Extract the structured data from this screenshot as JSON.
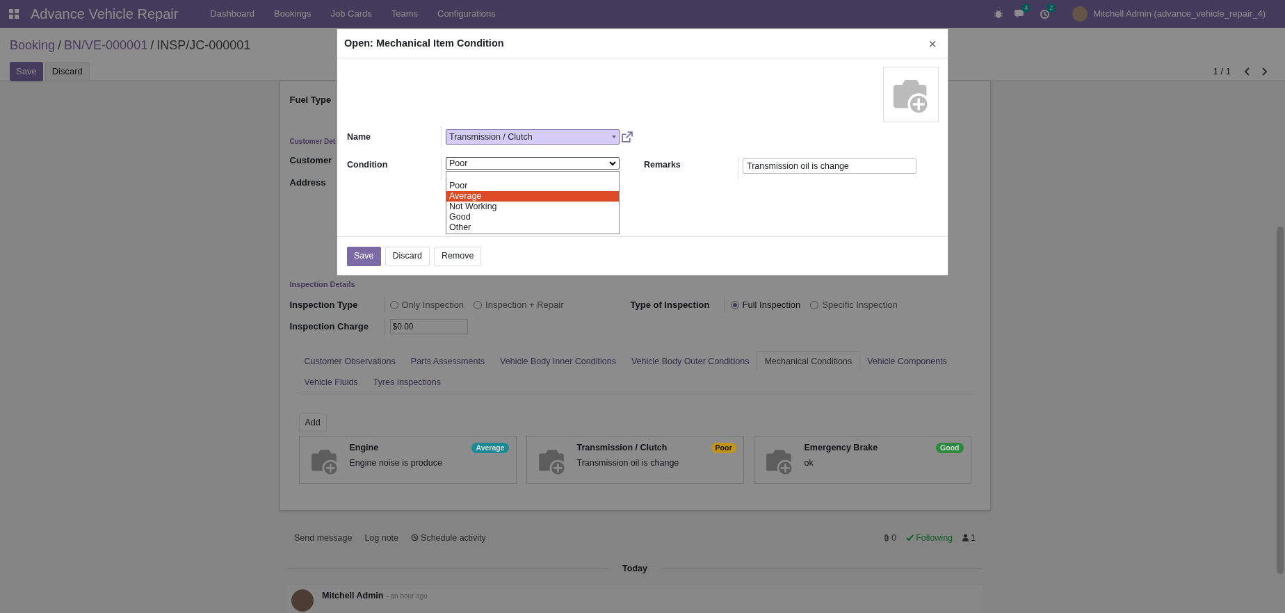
{
  "navbar": {
    "app_title": "Advance Vehicle Repair",
    "menu": [
      "Dashboard",
      "Bookings",
      "Job Cards",
      "Teams",
      "Configurations"
    ],
    "messages_count": "4",
    "activities_count": "2",
    "user": "Mitchell Admin (advance_vehicle_repair_4)"
  },
  "breadcrumb": [
    {
      "label": "Booking",
      "separator": "/"
    },
    {
      "label": "BN/VE-000001",
      "separator": "/"
    },
    {
      "label": "INSP/JC-000001"
    }
  ],
  "buttons": [
    "Save",
    "Discard"
  ],
  "pager": "1 / 1",
  "form": {
    "fuel_label": "Fuel Type",
    "customer_section": "Customer Det",
    "customer_label": "Customer",
    "address_label": "Address",
    "inspection_section": "Inspection Details",
    "inspection_type": {
      "label": "Inspection Type",
      "options": [
        {
          "label": "Only Inspection",
          "selected": false
        },
        {
          "label": "Inspection + Repair",
          "selected": false
        }
      ]
    },
    "type_of_inspection": {
      "label": "Type of Inspection",
      "options": [
        {
          "label": "Full Inspection",
          "selected": true
        },
        {
          "label": "Specific Inspection",
          "selected": false
        }
      ]
    },
    "charge": {
      "label": "Inspection Charge",
      "value": "$0.00"
    },
    "tabs": [
      {
        "label": "Customer Observations",
        "selected": false
      },
      {
        "label": "Parts Assessments",
        "selected": false
      },
      {
        "label": "Vehicle Body Inner Conditions",
        "selected": false
      },
      {
        "label": "Vehicle Body Outer Conditions",
        "selected": false
      },
      {
        "label": "Mechanical Conditions",
        "selected": true
      },
      {
        "label": "Vehicle Components",
        "selected": false
      },
      {
        "label": "Vehicle Fluids",
        "selected": false
      },
      {
        "label": "Tyres Inspections",
        "selected": false
      }
    ],
    "add_button": "Add",
    "cards": [
      {
        "title": "Engine",
        "remark": "Engine noise is produce",
        "status": "Average",
        "color": "#1a8a96"
      },
      {
        "title": "Transmission / Clutch",
        "remark": "Transmission oil is change",
        "status": "Poor",
        "color": "#c0951a"
      },
      {
        "title": "Emergency Brake",
        "remark": "ok",
        "status": "Good",
        "color": "#2b8a3e"
      }
    ]
  },
  "chatter": {
    "actions": [
      "Send message",
      "Log note",
      "Schedule activity"
    ],
    "attachments": "0",
    "following": "Following",
    "followers": "1",
    "divider": "Today",
    "message": {
      "author": "Mitchell Admin",
      "time": "- an hour ago"
    }
  },
  "dialog": {
    "title": "Open: Mechanical Item Condition",
    "close": "×",
    "name_label": "Name",
    "name_value": "Transmission / Clutch",
    "condition_label": "Condition",
    "condition_value": "Poor",
    "remarks_label": "Remarks",
    "remarks_value": "Transmission oil is change",
    "buttons": [
      "Save",
      "Discard",
      "Remove"
    ],
    "options": [
      {
        "label": "Poor",
        "highlighted": false
      },
      {
        "label": "Average",
        "highlighted": true
      },
      {
        "label": "Not Working",
        "highlighted": false
      },
      {
        "label": "Good",
        "highlighted": false
      },
      {
        "label": "Other",
        "highlighted": false
      }
    ]
  }
}
